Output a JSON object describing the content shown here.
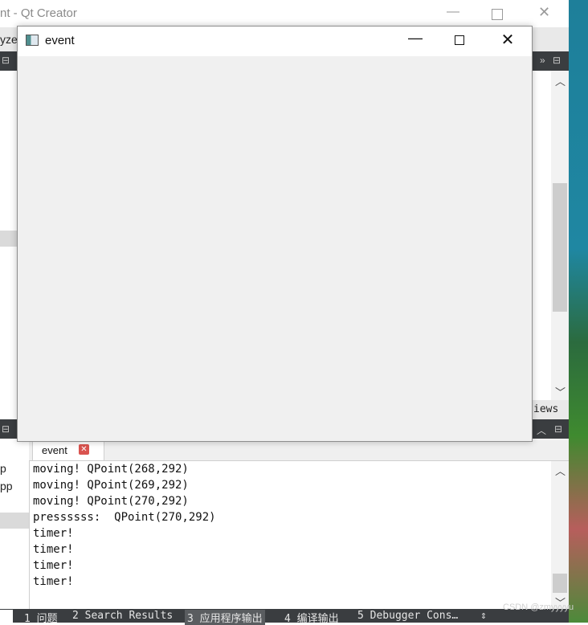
{
  "qt_creator": {
    "title": "nt - Qt Creator",
    "menu_fragment": "yze",
    "views_label": "iews"
  },
  "event_window": {
    "title": "event",
    "minimize_glyph": "—",
    "close_glyph": "✕"
  },
  "output_pane": {
    "tab_label": "event",
    "left_fragments": [
      "p",
      "pp"
    ],
    "lines": [
      "moving! QPoint(268,292)",
      "moving! QPoint(269,292)",
      "moving! QPoint(270,292)",
      "pressssss:  QPoint(270,292)",
      "timer!",
      "timer!",
      "timer!",
      "timer!"
    ]
  },
  "status_bar": {
    "items": [
      {
        "label": "1 问题"
      },
      {
        "label": "2 Search Results"
      },
      {
        "label": "3 应用程序输出"
      },
      {
        "label": "4 编译输出"
      },
      {
        "label": "5 Debugger Cons…"
      }
    ]
  },
  "watermark": "CSDN @zmyyyyu"
}
